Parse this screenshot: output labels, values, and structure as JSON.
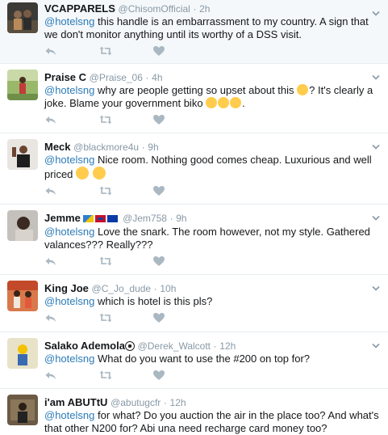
{
  "tweets": [
    {
      "name": "VCAPPARELS",
      "handle": "@ChisomOfficial",
      "sep": "·",
      "time": "2h",
      "mention": "@hotelsng",
      "text": " this handle is an embarrassment to my country. A sign that we don't monitor anything until its worthy of a DSS visit."
    },
    {
      "name": "Praise C",
      "handle": "@Praise_06",
      "sep": "·",
      "time": "4h",
      "mention": "@hotelsng",
      "text_a": " why are people getting so upset about this ",
      "text_b": "? It's clearly a joke. Blame your government biko ",
      "text_c": "."
    },
    {
      "name": "Meck",
      "handle": "@blackmore4u",
      "sep": "·",
      "time": "9h",
      "mention": "@hotelsng",
      "text": " Nice room. Nothing good comes cheap. Luxurious and well priced "
    },
    {
      "name": "Jemme",
      "handle": "@Jem758",
      "sep": "·",
      "time": "9h",
      "mention": "@hotelsng",
      "text": " Love the snark. The room however, not my style. Gathered valances??? Really???"
    },
    {
      "name": "King Joe",
      "handle": "@C_Jo_dude",
      "sep": "·",
      "time": "10h",
      "mention": "@hotelsng",
      "text": " which is hotel is this pls?"
    },
    {
      "name": "Salako Ademola",
      "handle": "@Derek_Walcott",
      "sep": "·",
      "time": "12h",
      "mention": "@hotelsng",
      "text": " What do you want to use the #200 on top for?"
    },
    {
      "name": "i'am ABUTtU",
      "handle": "@abutugcfr",
      "sep": "·",
      "time": "12h",
      "mention": "@hotelsng",
      "text": " for what? Do you auction the air in the place too? And what's that other N200 for? Abi una need recharge card money too?"
    }
  ],
  "icons": {
    "reply": "reply-icon",
    "retweet": "retweet-icon",
    "like": "heart-icon",
    "menu": "chevron-down-icon"
  },
  "colors": {
    "mention": "#2b7bb9",
    "meta": "#8899a6",
    "action_icon": "#aab8c2",
    "separator": "#e6ecf0",
    "highlight_bg": "#f5f8fa"
  }
}
